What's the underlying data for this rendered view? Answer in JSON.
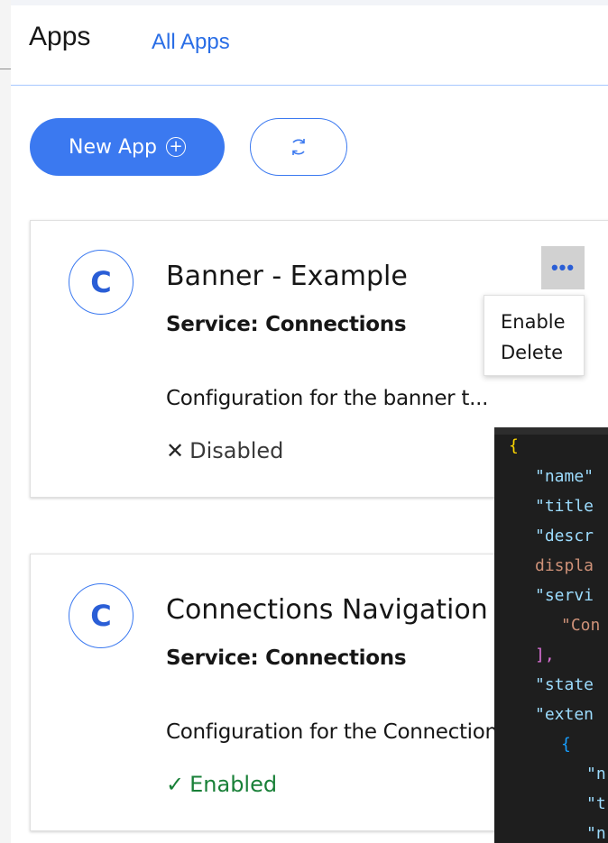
{
  "header": {
    "title": "Apps",
    "all_apps_link": "All Apps"
  },
  "toolbar": {
    "new_app_label": "New App",
    "plus_glyph": "+",
    "refresh_icon": "refresh-icon"
  },
  "cards": [
    {
      "avatar_letter": "C",
      "title": "Banner - Example",
      "service": "Service: Connections",
      "description": "Configuration for the banner t...",
      "status_glyph": "✕",
      "status": "Disabled",
      "overflow_glyph": "•••",
      "menu": [
        "Enable",
        "Delete"
      ]
    },
    {
      "avatar_letter": "C",
      "title": "Connections Navigation",
      "service": "Service: Connections",
      "description": "Configuration for the Connections",
      "status_glyph": "✓",
      "status": "Enabled"
    }
  ],
  "code_editor": {
    "lines": [
      "{",
      "\"name\"",
      "\"title",
      "\"descr",
      "displa",
      "\"servi",
      "\"Con",
      "],",
      "\"state",
      "\"exten",
      "{",
      "\"n",
      "\"t",
      "\"n"
    ]
  },
  "colors": {
    "accent": "#3b79f0",
    "link": "#2a6ee6",
    "enabled": "#198038",
    "editor_bg": "#1e1e1e"
  }
}
